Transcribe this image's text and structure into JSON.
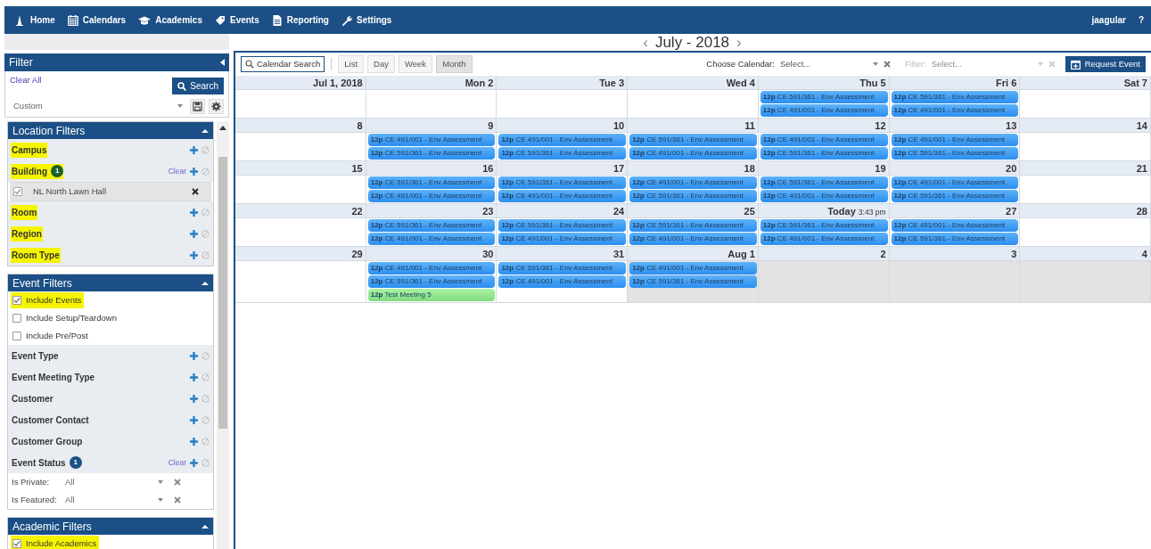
{
  "nav": {
    "items": [
      "Home",
      "Calendars",
      "Academics",
      "Events",
      "Reporting",
      "Settings"
    ],
    "user": "jaagular",
    "help": "?"
  },
  "month_nav": {
    "prev": "‹",
    "title": "July - 2018",
    "next": "›"
  },
  "filter_panel": {
    "title": "Filter",
    "clear_all": "Clear All",
    "search_button": "Search",
    "saved_filter": "Custom"
  },
  "sections": [
    {
      "title": "Location Filters",
      "items": [
        {
          "kind": "filter",
          "label": "Campus",
          "highlighted": true
        },
        {
          "kind": "filter",
          "label": "Building",
          "highlighted": true,
          "badge": "1",
          "color": "#1d5e2a",
          "clear": "Clear"
        },
        {
          "kind": "selected_value",
          "label": "NL North Lawn Hall",
          "checked": true
        },
        {
          "kind": "filter",
          "label": "Room",
          "highlighted": true
        },
        {
          "kind": "filter",
          "label": "Region",
          "highlighted": true
        },
        {
          "kind": "filter",
          "label": "Room Type",
          "highlighted": true
        }
      ]
    },
    {
      "title": "Event Filters",
      "items": [
        {
          "kind": "checkbox",
          "label": "Include Events",
          "checked": true,
          "highlighted": true
        },
        {
          "kind": "checkbox",
          "label": "Include Setup/Teardown",
          "checked": false,
          "highlighted": false
        },
        {
          "kind": "checkbox",
          "label": "Include Pre/Post",
          "checked": false,
          "highlighted": false
        },
        {
          "kind": "filter",
          "label": "Event Type",
          "highlighted": false
        },
        {
          "kind": "filter",
          "label": "Event Meeting Type",
          "highlighted": false
        },
        {
          "kind": "filter",
          "label": "Customer",
          "highlighted": false
        },
        {
          "kind": "filter",
          "label": "Customer Contact",
          "highlighted": false
        },
        {
          "kind": "filter",
          "label": "Customer Group",
          "highlighted": false
        },
        {
          "kind": "filter",
          "label": "Event Status",
          "highlighted": false,
          "badge": "1",
          "color": "#1b4f85",
          "clear": "Clear"
        },
        {
          "kind": "dropdown",
          "label": "Is Private:",
          "value": "All"
        },
        {
          "kind": "dropdown",
          "label": "Is Featured:",
          "value": "All"
        }
      ]
    },
    {
      "title": "Academic Filters",
      "items": [
        {
          "kind": "checkbox",
          "label": "Include Academics",
          "checked": true,
          "highlighted": true
        }
      ]
    }
  ],
  "toolbar": {
    "search": "Calendar Search",
    "views": [
      {
        "label": "List",
        "selected": false
      },
      {
        "label": "Day",
        "selected": false
      },
      {
        "label": "Week",
        "selected": false
      },
      {
        "label": "Month",
        "selected": true
      }
    ],
    "choose_calendar": {
      "label": "Choose Calendar:",
      "placeholder": "Select...",
      "disabled": false
    },
    "filter": {
      "label": "Filter:",
      "placeholder": "Select...",
      "disabled": true
    },
    "request_button": "Request Event"
  },
  "calendar": {
    "weeks": [
      {
        "days": [
          {
            "label": "Jul 1, 2018",
            "other_month": false
          },
          {
            "label": "Mon 2",
            "other_month": false
          },
          {
            "label": "Tue 3",
            "other_month": false
          },
          {
            "label": "Wed 4",
            "other_month": false
          },
          {
            "label": "Thu 5",
            "other_month": false,
            "events": [
              {
                "kind": "course",
                "time": "12p",
                "title": "CE 591/361 - Env Assessment"
              },
              {
                "kind": "course",
                "time": "12p",
                "title": "CE 491/001 - Env Assessment"
              }
            ]
          },
          {
            "label": "Fri 6",
            "other_month": false,
            "events": [
              {
                "kind": "course",
                "time": "12p",
                "title": "CE 591/361 - Env Assessment"
              },
              {
                "kind": "course",
                "time": "12p",
                "title": "CE 491/001 - Env Assessment"
              }
            ]
          },
          {
            "label": "Sat 7",
            "other_month": false
          }
        ]
      },
      {
        "days": [
          {
            "label": "8",
            "other_month": false
          },
          {
            "label": "9",
            "other_month": false,
            "events": [
              {
                "kind": "course",
                "time": "12p",
                "title": "CE 491/001 - Env Assessment"
              },
              {
                "kind": "course",
                "time": "12p",
                "title": "CE 591/361 - Env Assessment"
              }
            ]
          },
          {
            "label": "10",
            "other_month": false,
            "events": [
              {
                "kind": "course",
                "time": "12p",
                "title": "CE 491/001 - Env Assessment"
              },
              {
                "kind": "course",
                "time": "12p",
                "title": "CE 591/361 - Env Assessment"
              }
            ]
          },
          {
            "label": "11",
            "other_month": false,
            "events": [
              {
                "kind": "course",
                "time": "12p",
                "title": "CE 591/361 - Env Assessment"
              },
              {
                "kind": "course",
                "time": "12p",
                "title": "CE 491/001 - Env Assessment"
              }
            ]
          },
          {
            "label": "12",
            "other_month": false,
            "events": [
              {
                "kind": "course",
                "time": "12p",
                "title": "CE 491/001 - Env Assessment"
              },
              {
                "kind": "course",
                "time": "12p",
                "title": "CE 591/361 - Env Assessment"
              }
            ]
          },
          {
            "label": "13",
            "other_month": false,
            "events": [
              {
                "kind": "course",
                "time": "12p",
                "title": "CE 491/001 - Env Assessment"
              },
              {
                "kind": "course",
                "time": "12p",
                "title": "CE 591/361 - Env Assessment"
              }
            ]
          },
          {
            "label": "14",
            "other_month": false
          }
        ]
      },
      {
        "days": [
          {
            "label": "15",
            "other_month": false
          },
          {
            "label": "16",
            "other_month": false,
            "events": [
              {
                "kind": "course",
                "time": "12p",
                "title": "CE 591/361 - Env Assessment"
              },
              {
                "kind": "course",
                "time": "12p",
                "title": "CE 491/001 - Env Assessment"
              }
            ]
          },
          {
            "label": "17",
            "other_month": false,
            "events": [
              {
                "kind": "course",
                "time": "12p",
                "title": "CE 591/361 - Env Assessment"
              },
              {
                "kind": "course",
                "time": "12p",
                "title": "CE 491/001 - Env Assessment"
              }
            ]
          },
          {
            "label": "18",
            "other_month": false,
            "events": [
              {
                "kind": "course",
                "time": "12p",
                "title": "CE 491/001 - Env Assessment"
              },
              {
                "kind": "course",
                "time": "12p",
                "title": "CE 591/361 - Env Assessment"
              }
            ]
          },
          {
            "label": "19",
            "other_month": false,
            "events": [
              {
                "kind": "course",
                "time": "12p",
                "title": "CE 591/361 - Env Assessment"
              },
              {
                "kind": "course",
                "time": "12p",
                "title": "CE 491/001 - Env Assessment"
              }
            ]
          },
          {
            "label": "20",
            "other_month": false,
            "events": [
              {
                "kind": "course",
                "time": "12p",
                "title": "CE 491/001 - Env Assessment"
              },
              {
                "kind": "course",
                "time": "12p",
                "title": "CE 591/361 - Env Assessment"
              }
            ]
          },
          {
            "label": "21",
            "other_month": false
          }
        ]
      },
      {
        "days": [
          {
            "label": "22",
            "other_month": false
          },
          {
            "label": "23",
            "other_month": false,
            "events": [
              {
                "kind": "course",
                "time": "12p",
                "title": "CE 591/361 - Env Assessment"
              },
              {
                "kind": "course",
                "time": "12p",
                "title": "CE 491/001 - Env Assessment"
              }
            ]
          },
          {
            "label": "24",
            "other_month": false,
            "events": [
              {
                "kind": "course",
                "time": "12p",
                "title": "CE 591/361 - Env Assessment"
              },
              {
                "kind": "course",
                "time": "12p",
                "title": "CE 491/001 - Env Assessment"
              }
            ]
          },
          {
            "label": "25",
            "other_month": false,
            "events": [
              {
                "kind": "course",
                "time": "12p",
                "title": "CE 591/361 - Env Assessment"
              },
              {
                "kind": "course",
                "time": "12p",
                "title": "CE 491/001 - Env Assessment"
              }
            ]
          },
          {
            "label": "Today",
            "time": "3:43 pm",
            "other_month": false,
            "events": [
              {
                "kind": "course",
                "time": "12p",
                "title": "CE 591/361 - Env Assessment"
              },
              {
                "kind": "course",
                "time": "12p",
                "title": "CE 491/001 - Env Assessment"
              }
            ]
          },
          {
            "label": "27",
            "other_month": false,
            "events": [
              {
                "kind": "course",
                "time": "12p",
                "title": "CE 491/001 - Env Assessment"
              },
              {
                "kind": "course",
                "time": "12p",
                "title": "CE 591/361 - Env Assessment"
              }
            ]
          },
          {
            "label": "28",
            "other_month": false
          }
        ]
      },
      {
        "days": [
          {
            "label": "29",
            "other_month": false
          },
          {
            "label": "30",
            "other_month": false,
            "events": [
              {
                "kind": "course",
                "time": "12p",
                "title": "CE 491/001 - Env Assessment"
              },
              {
                "kind": "course",
                "time": "12p",
                "title": "CE 591/361 - Env Assessment"
              },
              {
                "kind": "meeting",
                "time": "12p",
                "title": "Test Meeting 5"
              }
            ]
          },
          {
            "label": "31",
            "other_month": false,
            "events": [
              {
                "kind": "course",
                "time": "12p",
                "title": "CE 591/361 - Env Assessment"
              },
              {
                "kind": "course",
                "time": "12p",
                "title": "CE 491/001 - Env Assessment"
              }
            ]
          },
          {
            "label": "Aug 1",
            "other_month": true,
            "events": [
              {
                "kind": "course",
                "time": "12p",
                "title": "CE 491/001 - Env Assessment"
              },
              {
                "kind": "course",
                "time": "12p",
                "title": "CE 591/361 - Env Assessment"
              }
            ]
          },
          {
            "label": "2",
            "other_month": true
          },
          {
            "label": "3",
            "other_month": true
          },
          {
            "label": "4",
            "other_month": true
          }
        ]
      }
    ]
  }
}
